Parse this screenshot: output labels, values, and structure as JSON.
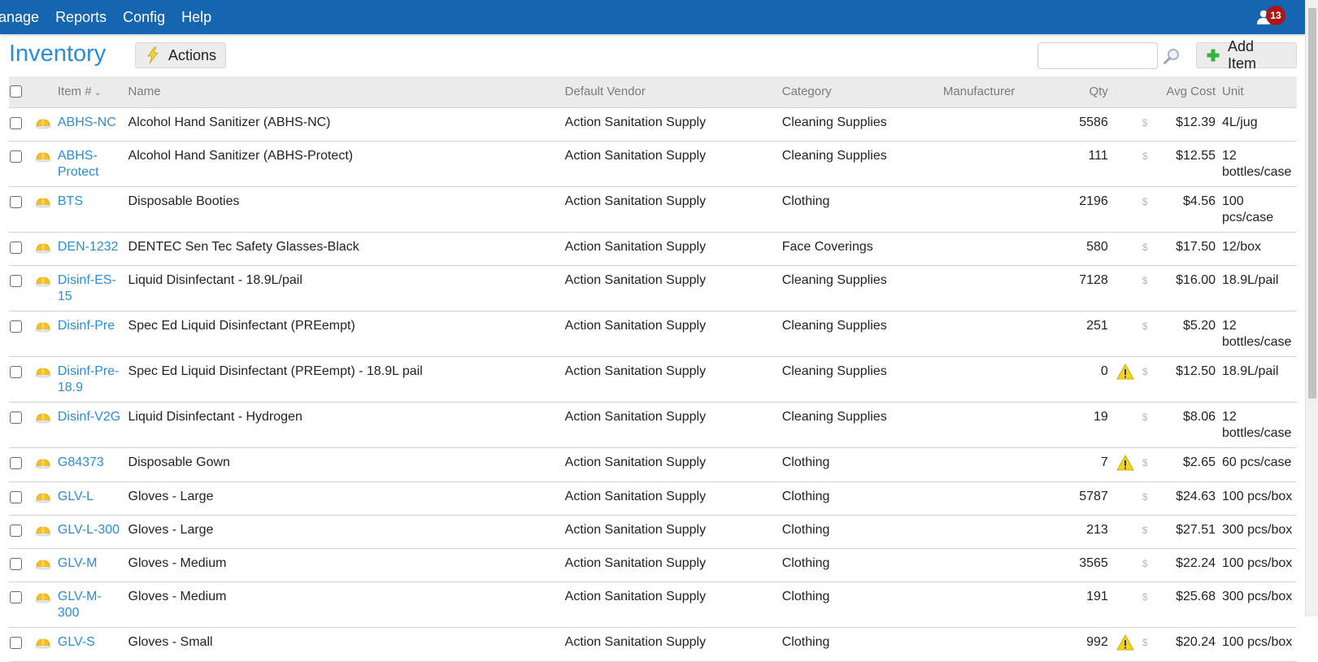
{
  "topnav": {
    "items": [
      "anage",
      "Reports",
      "Config",
      "Help"
    ],
    "notification_count": "13"
  },
  "page": {
    "title": "Inventory",
    "actions_label": "Actions",
    "add_item_label": "Add Item",
    "search_value": "",
    "search_placeholder": ""
  },
  "colors": {
    "topbar": "#1565b0",
    "accent_link": "#2e8bd6",
    "badge": "#b01515"
  },
  "table": {
    "headers": {
      "item": "Item #",
      "name": "Name",
      "vendor": "Default Vendor",
      "category": "Category",
      "manufacturer": "Manufacturer",
      "qty": "Qty",
      "avg_cost": "Avg Cost",
      "unit": "Unit"
    },
    "sort_indicator": "chevron-down",
    "rows": [
      {
        "item": "ABHS-NC",
        "name": "Alcohol Hand Sanitizer (ABHS-NC)",
        "vendor": "Action Sanitation Supply",
        "category": "Cleaning Supplies",
        "manufacturer": "",
        "qty": "5586",
        "warning": false,
        "avg_cost": "$12.39",
        "unit": "4L/jug"
      },
      {
        "item": "ABHS-Protect",
        "name": "Alcohol Hand Sanitizer (ABHS-Protect)",
        "vendor": "Action Sanitation Supply",
        "category": "Cleaning Supplies",
        "manufacturer": "",
        "qty": "111",
        "warning": false,
        "avg_cost": "$12.55",
        "unit": "12 bottles/case"
      },
      {
        "item": "BTS",
        "name": "Disposable Booties",
        "vendor": "Action Sanitation Supply",
        "category": "Clothing",
        "manufacturer": "",
        "qty": "2196",
        "warning": false,
        "avg_cost": "$4.56",
        "unit": "100 pcs/case"
      },
      {
        "item": "DEN-1232",
        "name": "DENTEC Sen Tec Safety Glasses-Black",
        "vendor": "Action Sanitation Supply",
        "category": "Face Coverings",
        "manufacturer": "",
        "qty": "580",
        "warning": false,
        "avg_cost": "$17.50",
        "unit": "12/box"
      },
      {
        "item": "Disinf-ES-15",
        "name": "Liquid Disinfectant - 18.9L/pail",
        "vendor": "Action Sanitation Supply",
        "category": "Cleaning Supplies",
        "manufacturer": "",
        "qty": "7128",
        "warning": false,
        "avg_cost": "$16.00",
        "unit": "18.9L/pail"
      },
      {
        "item": "Disinf-Pre",
        "name": "Spec Ed Liquid Disinfectant (PREempt)",
        "vendor": "Action Sanitation Supply",
        "category": "Cleaning Supplies",
        "manufacturer": "",
        "qty": "251",
        "warning": false,
        "avg_cost": "$5.20",
        "unit": "12 bottles/case"
      },
      {
        "item": "Disinf-Pre-18.9",
        "name": "Spec Ed Liquid Disinfectant (PREempt) - 18.9L pail",
        "vendor": "Action Sanitation Supply",
        "category": "Cleaning Supplies",
        "manufacturer": "",
        "qty": "0",
        "warning": true,
        "avg_cost": "$12.50",
        "unit": "18.9L/pail"
      },
      {
        "item": "Disinf-V2G",
        "name": "Liquid Disinfectant - Hydrogen",
        "vendor": "Action Sanitation Supply",
        "category": "Cleaning Supplies",
        "manufacturer": "",
        "qty": "19",
        "warning": false,
        "avg_cost": "$8.06",
        "unit": "12 bottles/case"
      },
      {
        "item": "G84373",
        "name": "Disposable Gown",
        "vendor": "Action Sanitation Supply",
        "category": "Clothing",
        "manufacturer": "",
        "qty": "7",
        "warning": true,
        "avg_cost": "$2.65",
        "unit": "60 pcs/case"
      },
      {
        "item": "GLV-L",
        "name": "Gloves - Large",
        "vendor": "Action Sanitation Supply",
        "category": "Clothing",
        "manufacturer": "",
        "qty": "5787",
        "warning": false,
        "avg_cost": "$24.63",
        "unit": "100 pcs/box"
      },
      {
        "item": "GLV-L-300",
        "name": "Gloves - Large",
        "vendor": "Action Sanitation Supply",
        "category": "Clothing",
        "manufacturer": "",
        "qty": "213",
        "warning": false,
        "avg_cost": "$27.51",
        "unit": "300 pcs/box"
      },
      {
        "item": "GLV-M",
        "name": "Gloves - Medium",
        "vendor": "Action Sanitation Supply",
        "category": "Clothing",
        "manufacturer": "",
        "qty": "3565",
        "warning": false,
        "avg_cost": "$22.24",
        "unit": "100 pcs/box"
      },
      {
        "item": "GLV-M-300",
        "name": "Gloves - Medium",
        "vendor": "Action Sanitation Supply",
        "category": "Clothing",
        "manufacturer": "",
        "qty": "191",
        "warning": false,
        "avg_cost": "$25.68",
        "unit": "300 pcs/box"
      },
      {
        "item": "GLV-S",
        "name": "Gloves - Small",
        "vendor": "Action Sanitation Supply",
        "category": "Clothing",
        "manufacturer": "",
        "qty": "992",
        "warning": true,
        "avg_cost": "$20.24",
        "unit": "100 pcs/box"
      }
    ],
    "cost_marker": "$"
  }
}
